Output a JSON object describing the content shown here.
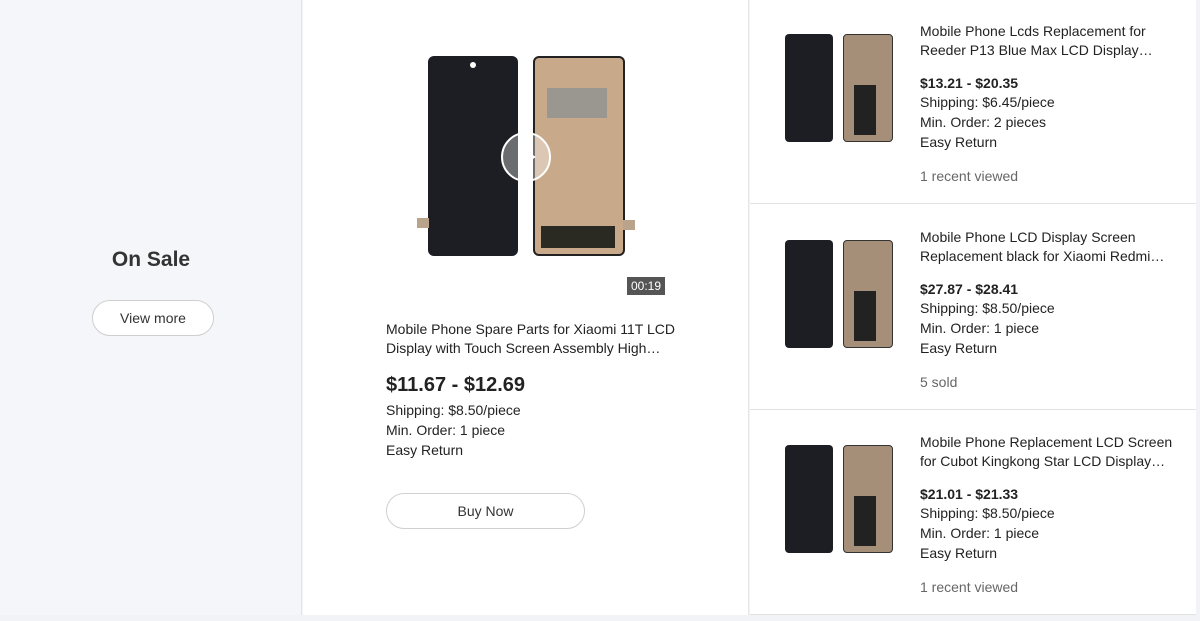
{
  "on_sale": {
    "title": "On Sale",
    "view_more_label": "View more"
  },
  "featured": {
    "video_duration": "00:19",
    "title": "Mobile Phone Spare Parts for Xiaomi 11T LCD Display with Touch Screen Assembly High…",
    "price": "$11.67 - $12.69",
    "shipping": "Shipping: $8.50/piece",
    "min_order": "Min. Order: 1 piece",
    "return": "Easy Return",
    "buy_label": "Buy Now"
  },
  "products": [
    {
      "title": "Mobile Phone Lcds Replacement for Reeder P13 Blue Max LCD Display Scree…",
      "price": "$13.21 - $20.35",
      "shipping": "Shipping: $6.45/piece",
      "min_order": "Min. Order: 2 pieces",
      "return": "Easy Return",
      "extra": "1 recent viewed"
    },
    {
      "title": "Mobile Phone LCD Display Screen Replacement black for Xiaomi Redmi No…",
      "price": "$27.87 - $28.41",
      "shipping": "Shipping: $8.50/piece",
      "min_order": "Min. Order: 1 piece",
      "return": "Easy Return",
      "extra": "5 sold"
    },
    {
      "title": "Mobile Phone Replacement LCD Screen for Cubot Kingkong Star LCD Display…",
      "price": "$21.01 - $21.33",
      "shipping": "Shipping: $8.50/piece",
      "min_order": "Min. Order: 1 piece",
      "return": "Easy Return",
      "extra": "1 recent viewed"
    }
  ]
}
